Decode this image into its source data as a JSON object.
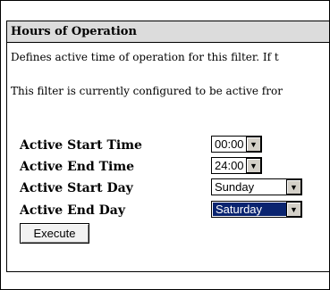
{
  "panel": {
    "title": "Hours of Operation",
    "description_line_1": "Defines active time of operation for this filter. If t",
    "description_line_2": "This filter is currently configured to be active fror"
  },
  "form": {
    "active_start_time": {
      "label": "Active Start Time",
      "value": "00:00"
    },
    "active_end_time": {
      "label": "Active End Time",
      "value": "24:00"
    },
    "active_start_day": {
      "label": "Active Start Day",
      "value": "Sunday"
    },
    "active_end_day": {
      "label": "Active End Day",
      "value": "Saturday"
    }
  },
  "buttons": {
    "execute_label": "Execute"
  },
  "colors": {
    "header_background": "#dcdcdc",
    "selection_highlight": "#0a2470"
  },
  "icons": {
    "dropdown_arrow": "chevron-down-icon"
  }
}
